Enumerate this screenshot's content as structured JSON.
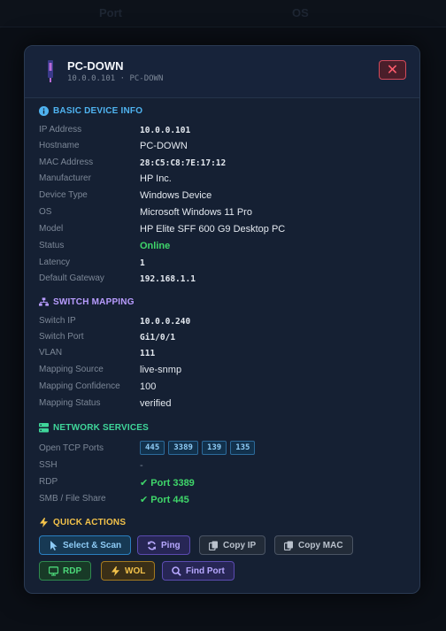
{
  "background": {
    "columns": [
      "Port",
      "OS"
    ]
  },
  "modal": {
    "title": "PC-DOWN",
    "subtitle": "10.0.0.101 · PC-DOWN",
    "close_label": "✕"
  },
  "basic": {
    "title": "BASIC DEVICE INFO",
    "rows": [
      {
        "label": "IP Address",
        "value": "10.0.0.101"
      },
      {
        "label": "Hostname",
        "value": "PC-DOWN"
      },
      {
        "label": "MAC Address",
        "value": "28:C5:C8:7E:17:12"
      },
      {
        "label": "Manufacturer",
        "value": "HP Inc."
      },
      {
        "label": "Device Type",
        "value": "Windows Device"
      },
      {
        "label": "OS",
        "value": "Microsoft Windows 11 Pro"
      },
      {
        "label": "Model",
        "value": "HP Elite SFF 600 G9 Desktop PC"
      },
      {
        "label": "Status",
        "value": "Online"
      },
      {
        "label": "Latency",
        "value": "1"
      },
      {
        "label": "Default Gateway",
        "value": "192.168.1.1"
      }
    ]
  },
  "switch": {
    "title": "SWITCH MAPPING",
    "rows": [
      {
        "label": "Switch IP",
        "value": "10.0.0.240"
      },
      {
        "label": "Switch Port",
        "value": "Gi1/0/1"
      },
      {
        "label": "VLAN",
        "value": "111"
      },
      {
        "label": "Mapping Source",
        "value": "live-snmp"
      },
      {
        "label": "Mapping Confidence",
        "value": "100"
      },
      {
        "label": "Mapping Status",
        "value": "verified"
      }
    ]
  },
  "services": {
    "title": "NETWORK SERVICES",
    "open_ports_label": "Open TCP Ports",
    "open_ports": [
      "445",
      "3389",
      "139",
      "135"
    ],
    "ssh_label": "SSH",
    "ssh_value": "-",
    "rdp_label": "RDP",
    "rdp_value": "✔ Port 3389",
    "smb_label": "SMB / File Share",
    "smb_value": "✔ Port 445"
  },
  "actions": {
    "title": "QUICK ACTIONS",
    "select_scan": "Select & Scan",
    "ping": "Ping",
    "copy_ip": "Copy IP",
    "copy_mac": "Copy MAC",
    "rdp": "RDP",
    "wol": "WOL",
    "find_port": "Find Port"
  },
  "colors": {
    "accent_blue": "#4fb3f0",
    "accent_purple": "#b89cff",
    "accent_green": "#3fd69a",
    "accent_amber": "#f3c24a",
    "status_online": "#3fd66a",
    "close_red": "#ff5d6e"
  }
}
